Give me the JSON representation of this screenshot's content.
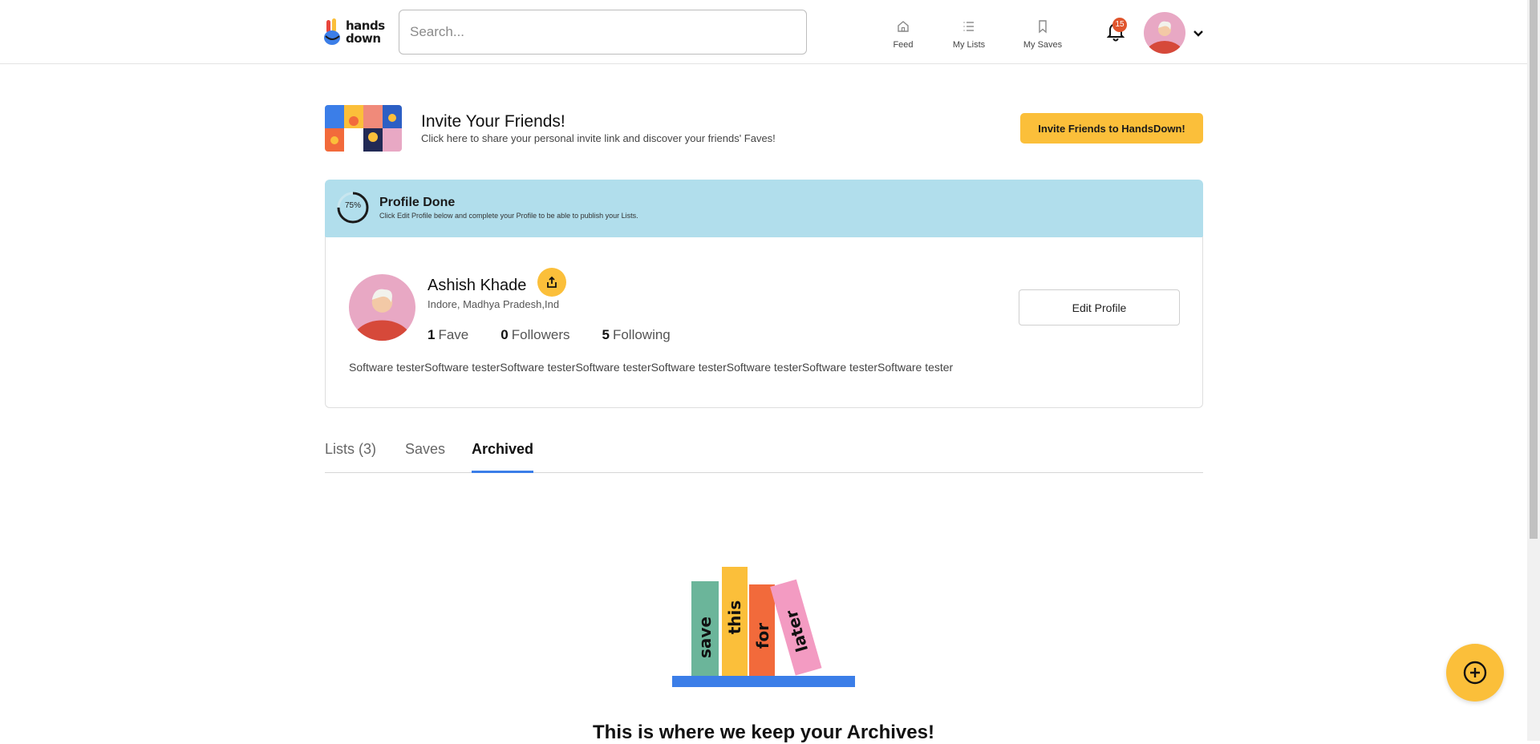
{
  "header": {
    "logo_line1": "hands",
    "logo_line2": "down",
    "search_placeholder": "Search...",
    "nav": [
      {
        "label": "Feed",
        "icon": "home-icon"
      },
      {
        "label": "My Lists",
        "icon": "list-icon"
      },
      {
        "label": "My Saves",
        "icon": "bookmark-icon"
      }
    ],
    "notification_count": "15"
  },
  "invite": {
    "title": "Invite Your Friends!",
    "subtitle": "Click here to share your personal invite link and discover your friends' Faves!",
    "button_label": "Invite Friends to HandsDown!"
  },
  "profile_progress": {
    "percent_label": "75%",
    "percent": 0.75,
    "title": "Profile Done",
    "subtitle": "Click Edit Profile below and complete your Profile to be able to publish your Lists."
  },
  "profile": {
    "name": "Ashish Khade",
    "location": "Indore, Madhya Pradesh,Ind",
    "stats": [
      {
        "value": "1",
        "label": "Fave"
      },
      {
        "value": "0",
        "label": "Followers"
      },
      {
        "value": "5",
        "label": "Following"
      }
    ],
    "bio": "Software testerSoftware testerSoftware testerSoftware testerSoftware testerSoftware testerSoftware testerSoftware tester",
    "edit_label": "Edit Profile"
  },
  "tabs": [
    {
      "label": "Lists (3)",
      "active": false
    },
    {
      "label": "Saves",
      "active": false
    },
    {
      "label": "Archived",
      "active": true
    }
  ],
  "empty_state": {
    "book_words": [
      "save",
      "this",
      "for",
      "later"
    ],
    "title": "This is where we keep your Archives!"
  },
  "colors": {
    "accent": "#fbbf3a",
    "progress_bg": "#b1deec",
    "tab_active": "#3b7ee8",
    "badge": "#e0552d",
    "avatar_bg": "#e8a8c4",
    "avatar_body": "#d6493a"
  }
}
